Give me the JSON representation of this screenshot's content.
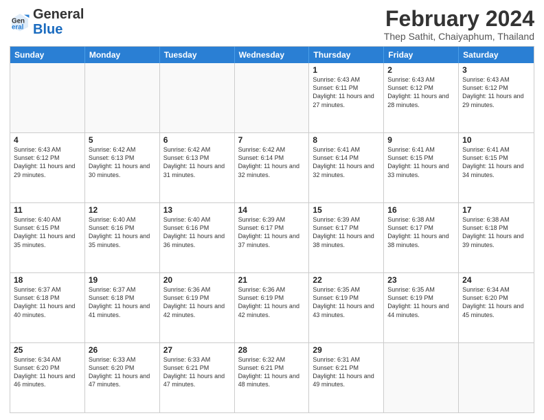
{
  "logo": {
    "text_general": "General",
    "text_blue": "Blue"
  },
  "title": {
    "month_year": "February 2024",
    "location": "Thep Sathit, Chaiyaphum, Thailand"
  },
  "header_days": [
    "Sunday",
    "Monday",
    "Tuesday",
    "Wednesday",
    "Thursday",
    "Friday",
    "Saturday"
  ],
  "weeks": [
    [
      {
        "day": "",
        "empty": true
      },
      {
        "day": "",
        "empty": true
      },
      {
        "day": "",
        "empty": true
      },
      {
        "day": "",
        "empty": true
      },
      {
        "day": "1",
        "sunrise": "6:43 AM",
        "sunset": "6:11 PM",
        "daylight": "11 hours and 27 minutes."
      },
      {
        "day": "2",
        "sunrise": "6:43 AM",
        "sunset": "6:12 PM",
        "daylight": "11 hours and 28 minutes."
      },
      {
        "day": "3",
        "sunrise": "6:43 AM",
        "sunset": "6:12 PM",
        "daylight": "11 hours and 29 minutes."
      }
    ],
    [
      {
        "day": "4",
        "sunrise": "6:43 AM",
        "sunset": "6:12 PM",
        "daylight": "11 hours and 29 minutes."
      },
      {
        "day": "5",
        "sunrise": "6:42 AM",
        "sunset": "6:13 PM",
        "daylight": "11 hours and 30 minutes."
      },
      {
        "day": "6",
        "sunrise": "6:42 AM",
        "sunset": "6:13 PM",
        "daylight": "11 hours and 31 minutes."
      },
      {
        "day": "7",
        "sunrise": "6:42 AM",
        "sunset": "6:14 PM",
        "daylight": "11 hours and 32 minutes."
      },
      {
        "day": "8",
        "sunrise": "6:41 AM",
        "sunset": "6:14 PM",
        "daylight": "11 hours and 32 minutes."
      },
      {
        "day": "9",
        "sunrise": "6:41 AM",
        "sunset": "6:15 PM",
        "daylight": "11 hours and 33 minutes."
      },
      {
        "day": "10",
        "sunrise": "6:41 AM",
        "sunset": "6:15 PM",
        "daylight": "11 hours and 34 minutes."
      }
    ],
    [
      {
        "day": "11",
        "sunrise": "6:40 AM",
        "sunset": "6:15 PM",
        "daylight": "11 hours and 35 minutes."
      },
      {
        "day": "12",
        "sunrise": "6:40 AM",
        "sunset": "6:16 PM",
        "daylight": "11 hours and 35 minutes."
      },
      {
        "day": "13",
        "sunrise": "6:40 AM",
        "sunset": "6:16 PM",
        "daylight": "11 hours and 36 minutes."
      },
      {
        "day": "14",
        "sunrise": "6:39 AM",
        "sunset": "6:17 PM",
        "daylight": "11 hours and 37 minutes."
      },
      {
        "day": "15",
        "sunrise": "6:39 AM",
        "sunset": "6:17 PM",
        "daylight": "11 hours and 38 minutes."
      },
      {
        "day": "16",
        "sunrise": "6:38 AM",
        "sunset": "6:17 PM",
        "daylight": "11 hours and 38 minutes."
      },
      {
        "day": "17",
        "sunrise": "6:38 AM",
        "sunset": "6:18 PM",
        "daylight": "11 hours and 39 minutes."
      }
    ],
    [
      {
        "day": "18",
        "sunrise": "6:37 AM",
        "sunset": "6:18 PM",
        "daylight": "11 hours and 40 minutes."
      },
      {
        "day": "19",
        "sunrise": "6:37 AM",
        "sunset": "6:18 PM",
        "daylight": "11 hours and 41 minutes."
      },
      {
        "day": "20",
        "sunrise": "6:36 AM",
        "sunset": "6:19 PM",
        "daylight": "11 hours and 42 minutes."
      },
      {
        "day": "21",
        "sunrise": "6:36 AM",
        "sunset": "6:19 PM",
        "daylight": "11 hours and 42 minutes."
      },
      {
        "day": "22",
        "sunrise": "6:35 AM",
        "sunset": "6:19 PM",
        "daylight": "11 hours and 43 minutes."
      },
      {
        "day": "23",
        "sunrise": "6:35 AM",
        "sunset": "6:19 PM",
        "daylight": "11 hours and 44 minutes."
      },
      {
        "day": "24",
        "sunrise": "6:34 AM",
        "sunset": "6:20 PM",
        "daylight": "11 hours and 45 minutes."
      }
    ],
    [
      {
        "day": "25",
        "sunrise": "6:34 AM",
        "sunset": "6:20 PM",
        "daylight": "11 hours and 46 minutes."
      },
      {
        "day": "26",
        "sunrise": "6:33 AM",
        "sunset": "6:20 PM",
        "daylight": "11 hours and 47 minutes."
      },
      {
        "day": "27",
        "sunrise": "6:33 AM",
        "sunset": "6:21 PM",
        "daylight": "11 hours and 47 minutes."
      },
      {
        "day": "28",
        "sunrise": "6:32 AM",
        "sunset": "6:21 PM",
        "daylight": "11 hours and 48 minutes."
      },
      {
        "day": "29",
        "sunrise": "6:31 AM",
        "sunset": "6:21 PM",
        "daylight": "11 hours and 49 minutes."
      },
      {
        "day": "",
        "empty": true
      },
      {
        "day": "",
        "empty": true
      }
    ]
  ]
}
